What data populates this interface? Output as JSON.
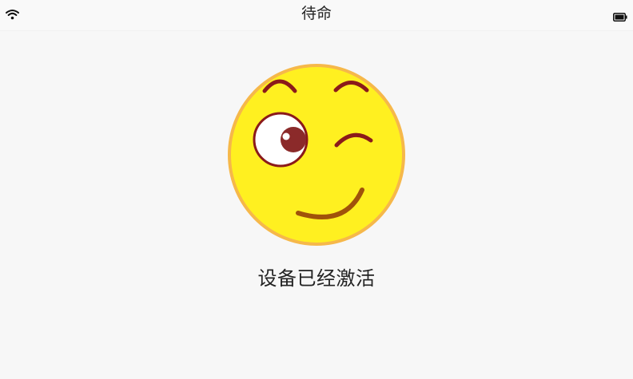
{
  "status_bar": {
    "title": "待命",
    "wifi_icon": "wifi-icon",
    "battery_icon": "battery-icon"
  },
  "main": {
    "face_icon": "winking-face-icon",
    "message": "设备已经激活"
  },
  "colors": {
    "face_fill": "#fff020",
    "face_border": "#f6b84a",
    "feature": "#8b1a1a",
    "smile": "#a0520a"
  }
}
